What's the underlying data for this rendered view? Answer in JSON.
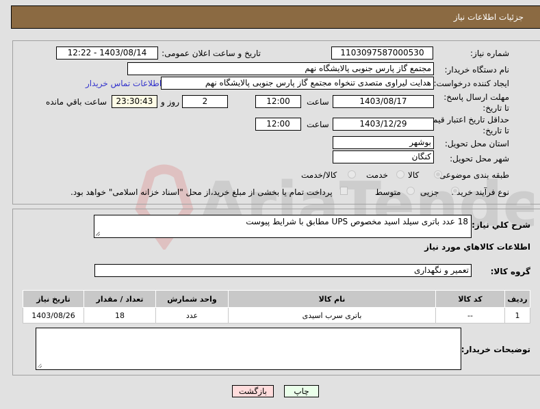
{
  "header": {
    "title": "جزئیات اطلاعات نیاز"
  },
  "form": {
    "need_number": {
      "label": "شماره نیاز:",
      "value": "1103097587000530"
    },
    "announce_datetime": {
      "label": "تاریخ و ساعت اعلان عمومی:",
      "value": "1403/08/14 - 12:22"
    },
    "buyer_org": {
      "label": "نام دستگاه خریدار:",
      "value": "مجتمع گاز پارس جنوبی  پالایشگاه نهم"
    },
    "requester": {
      "label": "ایجاد کننده درخواست:",
      "value": "هدایت لیراوی متصدی تنخواه مجتمع گاز پارس جنوبی  پالایشگاه نهم",
      "contact_link": "اطلاعات تماس خریدار"
    },
    "response_deadline": {
      "label": "مهلت ارسال پاسخ: تا تاریخ:",
      "date": "1403/08/17",
      "time_label": "ساعت",
      "time": "12:00",
      "days": "2",
      "days_label": "روز و",
      "remaining": "23:30:43",
      "remaining_label": "ساعت باقي مانده"
    },
    "price_validity": {
      "label": "حداقل تاریخ اعتبار قیمت: تا تاریخ:",
      "date": "1403/12/29",
      "time_label": "ساعت",
      "time": "12:00"
    },
    "province": {
      "label": "استان محل تحویل:",
      "value": "بوشهر"
    },
    "city": {
      "label": "شهر محل تحویل:",
      "value": "کنگان"
    },
    "category": {
      "label": "طبقه بندی موضوعی:",
      "options": [
        "کالا",
        "خدمت",
        "کالا/خدمت"
      ],
      "selected": "کالا"
    },
    "purchase_type": {
      "label": "نوع فرآیند خرید :",
      "options": [
        "جزیی",
        "متوسط"
      ],
      "selected": "جزیی",
      "treasury_note": "پرداخت تمام یا بخشی از مبلغ خرید،از محل \"اسناد خزانه اسلامی\" خواهد بود."
    }
  },
  "description": {
    "label": "شرح کلي نياز:",
    "value": "18 عدد باتری سیلد اسید مخصوص UPS مطابق با شرایط پیوست"
  },
  "goods_section": {
    "title": "اطلاعات کالاهاي مورد نياز",
    "group_label": "گروه کالا:",
    "group_value": "تعمیر و نگهداری",
    "table": {
      "headers": [
        "ردیف",
        "کد کالا",
        "نام کالا",
        "واحد شمارش",
        "تعداد / مقدار",
        "تاریخ نیاز"
      ],
      "rows": [
        [
          "1",
          "--",
          "باتری سرب اسیدی",
          "عدد",
          "18",
          "1403/08/26"
        ]
      ]
    }
  },
  "buyer_notes": {
    "label": "توضیحات خریدار:",
    "value": ""
  },
  "buttons": {
    "print": "چاپ",
    "back": "بازگشت"
  },
  "watermark": {
    "text": "AriaTender.net"
  },
  "colors": {
    "header_bg": "#8b6a42",
    "print_btn_bg": "#eaffea",
    "back_btn_bg": "#ffdcdc",
    "link": "#3333cc"
  }
}
